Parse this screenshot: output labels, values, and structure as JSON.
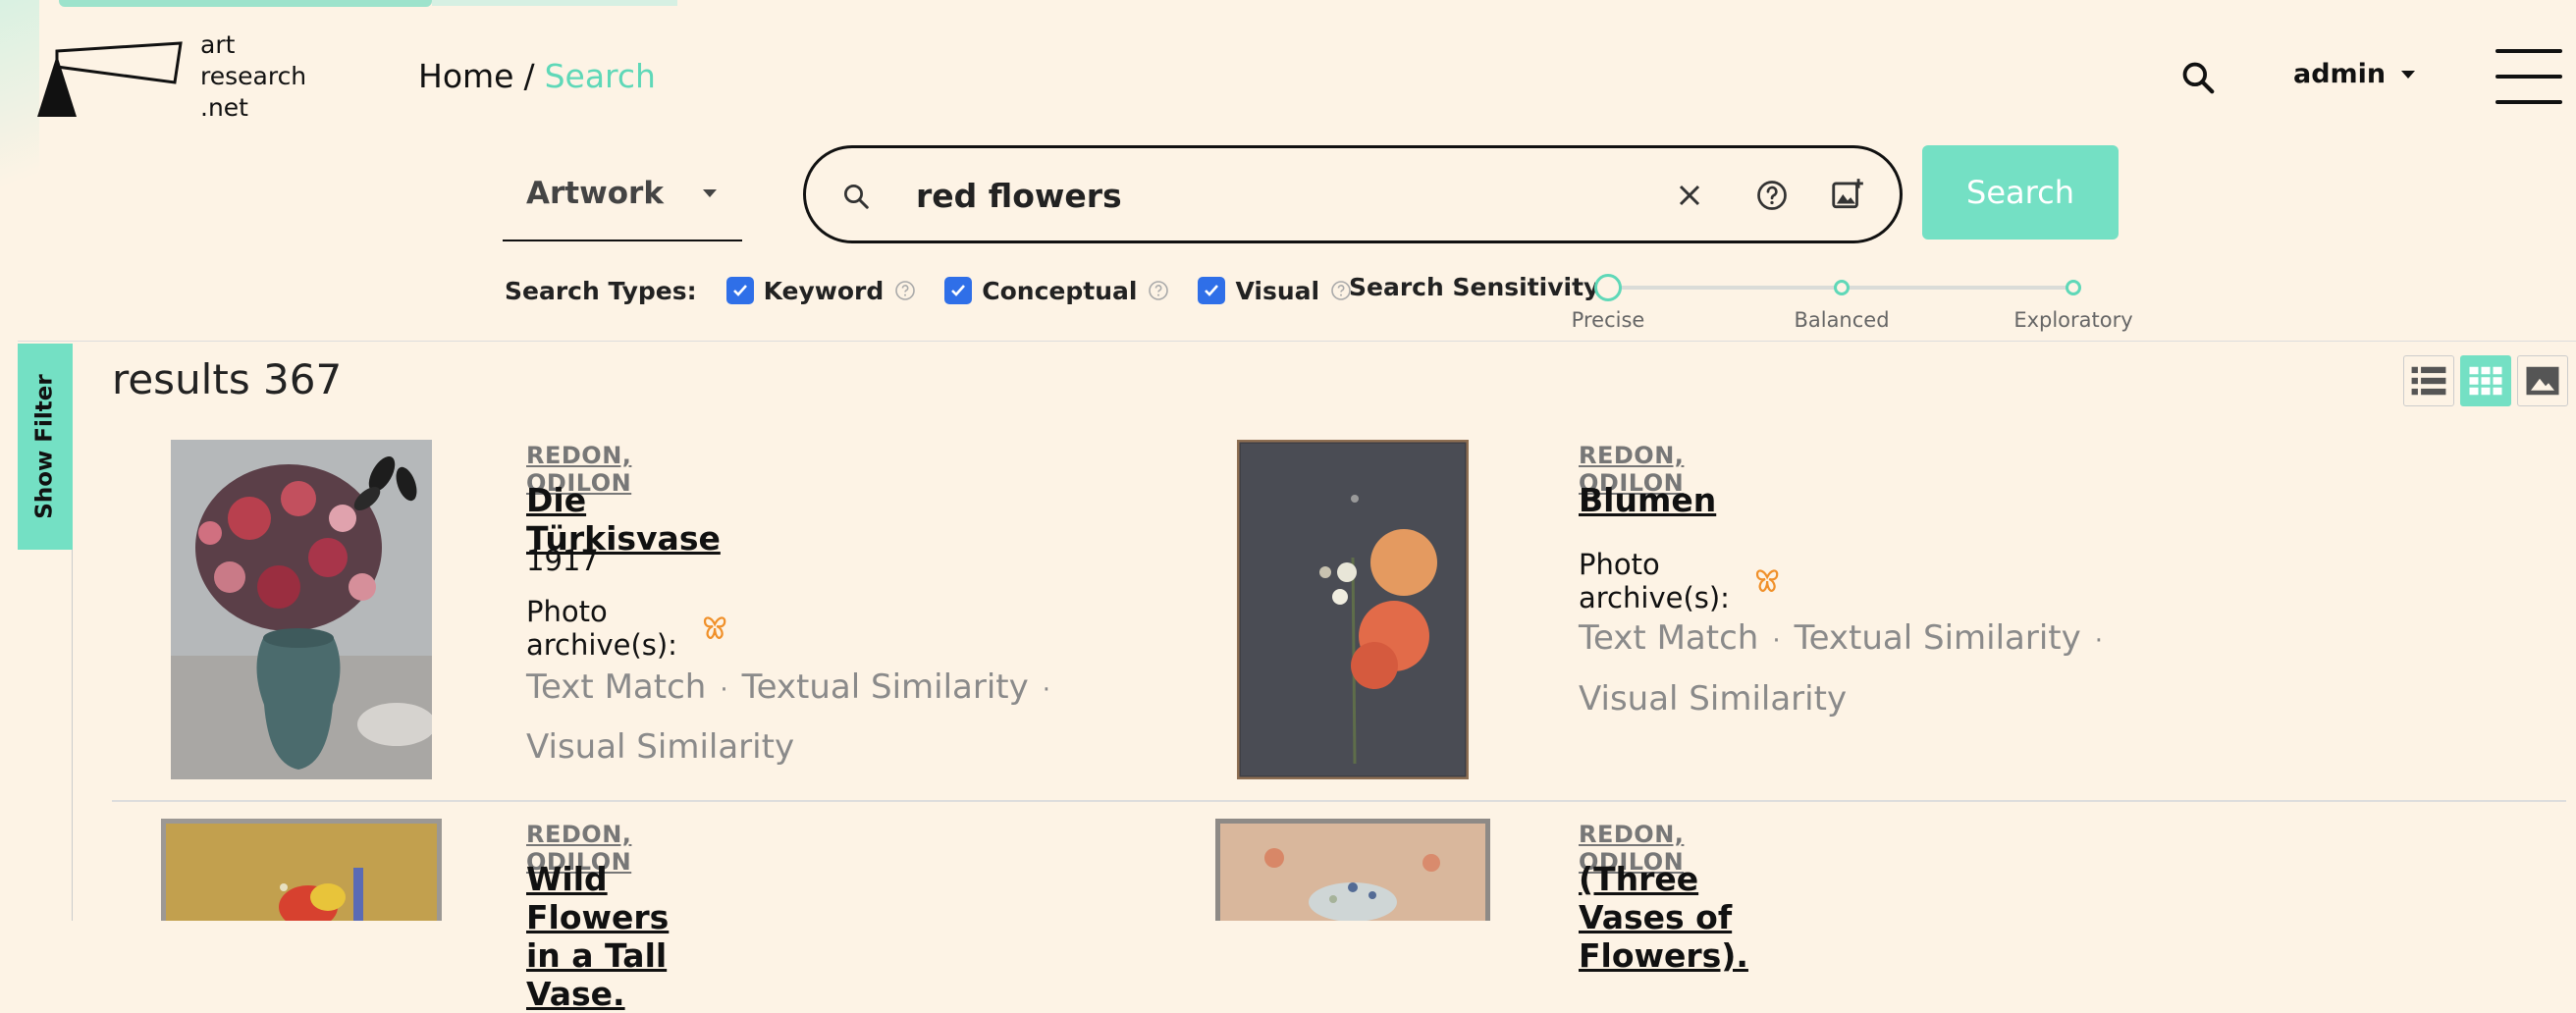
{
  "header": {
    "logo_lines": [
      "art",
      "research",
      ".net"
    ],
    "breadcrumb": {
      "home": "Home",
      "separator": "/",
      "current": "Search"
    },
    "user_label": "admin"
  },
  "search": {
    "type_selected": "Artwork",
    "query": "red flowers",
    "button_label": "Search"
  },
  "filters": {
    "search_types_label": "Search Types:",
    "types": [
      {
        "label": "Keyword",
        "checked": true
      },
      {
        "label": "Conceptual",
        "checked": true
      },
      {
        "label": "Visual",
        "checked": true
      }
    ],
    "sensitivity_label": "Search Sensitivity:",
    "sensitivity_stops": [
      "Precise",
      "Balanced",
      "Exploratory"
    ],
    "sensitivity_selected": "Precise"
  },
  "sidebar": {
    "toggle_label": "Show Filter"
  },
  "results": {
    "heading": "results 367",
    "view_modes": [
      "list",
      "grid",
      "image"
    ],
    "active_view": "grid",
    "items": [
      {
        "artist": "REDON, ODILON",
        "title": "Die Türkisvase",
        "date": "1917",
        "archive_label": "Photo archive(s):",
        "matches": [
          "Text Match",
          "Textual Similarity",
          "Visual Similarity"
        ]
      },
      {
        "artist": "REDON, ODILON",
        "title": "Blumen",
        "archive_label": "Photo archive(s):",
        "matches": [
          "Text Match",
          "Textual Similarity",
          "Visual Similarity"
        ]
      },
      {
        "artist": "REDON, ODILON",
        "title": "Wild Flowers in a Tall Vase."
      },
      {
        "artist": "REDON, ODILON",
        "title": "(Three Vases of Flowers)."
      }
    ]
  },
  "colors": {
    "accent": "#74e0c4",
    "background": "#fdf3e5",
    "checkbox": "#2f6fe8",
    "archive_icon": "#f0902a"
  }
}
